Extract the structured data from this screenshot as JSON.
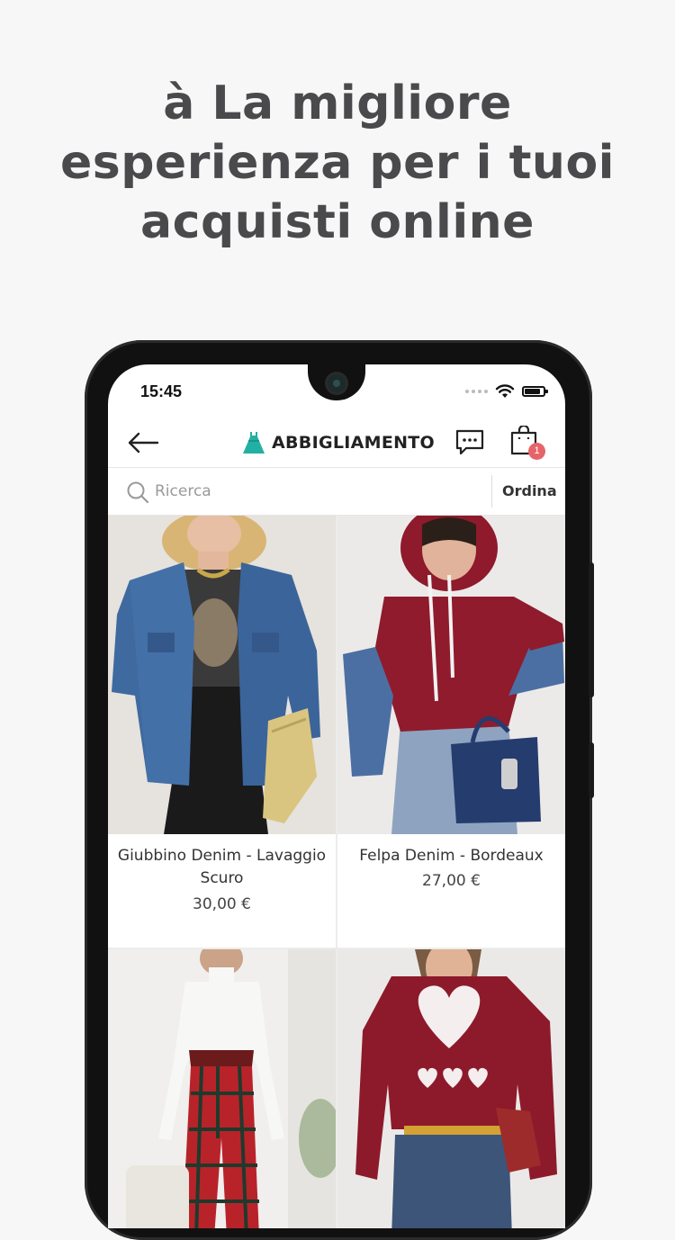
{
  "headline": {
    "line1": "à La migliore",
    "line2": "esperienza per i tuoi",
    "line3": "acquisti online"
  },
  "status_bar": {
    "time": "15:45"
  },
  "app_bar": {
    "title": "ABBIGLIAMENTO",
    "category_icon": "dress-icon",
    "cart_badge": "1"
  },
  "search": {
    "placeholder": "Ricerca",
    "sort_label": "Ordina"
  },
  "products": [
    {
      "name": "Giubbino Denim - Lavaggio Scuro",
      "price": "30,00 €"
    },
    {
      "name": "Felpa Denim - Bordeaux",
      "price": "27,00 €"
    },
    {
      "name": "",
      "price": ""
    },
    {
      "name": "",
      "price": ""
    }
  ],
  "colors": {
    "headline": "#4a4a4c",
    "badge": "#e5646a",
    "background": "#f7f7f8"
  }
}
